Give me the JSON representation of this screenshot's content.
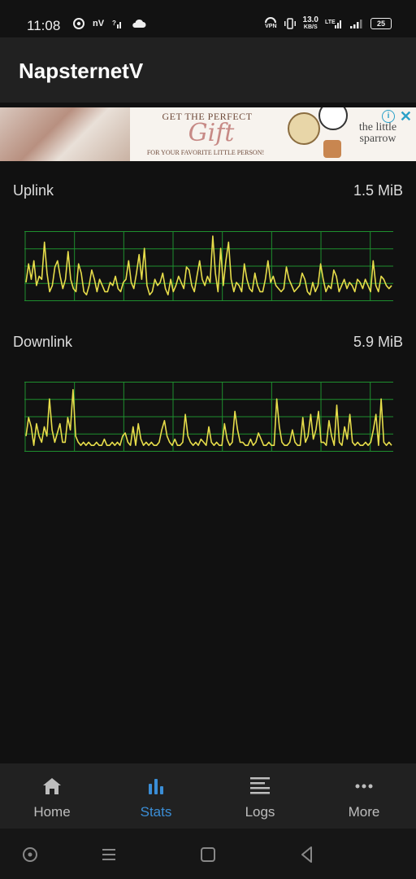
{
  "status_bar": {
    "time": "11:08",
    "carrier_badge": "nV",
    "network_speed": "13.0",
    "network_speed_unit": "KB/S",
    "vpn_label": "VPN",
    "battery": "25",
    "icons": [
      "chrome-icon",
      "signal-question-icon",
      "cloud-icon",
      "vpn-icon",
      "vibrate-icon",
      "lte-icon",
      "signal-icon",
      "battery-icon"
    ]
  },
  "app_bar": {
    "title": "NapsternetV"
  },
  "ad_banner": {
    "headline": "GET THE PERFECT",
    "gift_word": "Gift",
    "subline": "FOR YOUR FAVORITE LITTLE PERSON!",
    "brand": "the little sparrow",
    "info_glyph": "i",
    "close_glyph": "✕"
  },
  "uplink": {
    "label": "Uplink",
    "value": "1.5 MiB"
  },
  "downlink": {
    "label": "Downlink",
    "value": "5.9 MiB"
  },
  "chart_data": [
    {
      "type": "line",
      "series": [
        {
          "values": [
            0.25,
            0.55,
            0.3,
            0.6,
            0.2,
            0.35,
            0.3,
            0.9,
            0.4,
            0.1,
            0.2,
            0.5,
            0.6,
            0.35,
            0.15,
            0.3,
            0.75,
            0.3,
            0.15,
            0.1,
            0.55,
            0.4,
            0.1,
            0.05,
            0.2,
            0.45,
            0.3,
            0.1,
            0.3,
            0.2,
            0.1,
            0.1,
            0.25,
            0.2,
            0.35,
            0.15,
            0.1,
            0.25,
            0.3,
            0.6,
            0.25,
            0.15,
            0.4,
            0.7,
            0.3,
            0.8,
            0.2,
            0.05,
            0.1,
            0.3,
            0.2,
            0.25,
            0.4,
            0.15,
            0.05,
            0.3,
            0.1,
            0.2,
            0.35,
            0.25,
            0.15,
            0.5,
            0.45,
            0.2,
            0.1,
            0.35,
            0.6,
            0.3,
            0.2,
            0.35,
            0.25,
            1.0,
            0.4,
            0.1,
            0.8,
            0.2,
            0.6,
            0.9,
            0.3,
            0.1,
            0.25,
            0.2,
            0.1,
            0.55,
            0.3,
            0.15,
            0.1,
            0.4,
            0.2,
            0.1,
            0.1,
            0.3,
            0.6,
            0.25,
            0.35,
            0.2,
            0.15,
            0.1,
            0.15,
            0.5,
            0.3,
            0.2,
            0.1,
            0.15,
            0.2,
            0.4,
            0.3,
            0.1,
            0.05,
            0.25,
            0.1,
            0.2,
            0.55,
            0.3,
            0.1,
            0.2,
            0.15,
            0.45,
            0.35,
            0.1,
            0.2,
            0.3,
            0.15,
            0.25,
            0.2,
            0.1,
            0.3,
            0.25,
            0.15,
            0.3,
            0.2,
            0.1,
            0.6,
            0.2,
            0.1,
            0.35,
            0.3,
            0.2,
            0.15,
            0.2
          ]
        }
      ]
    },
    {
      "type": "line",
      "series": [
        {
          "values": [
            0.2,
            0.5,
            0.35,
            0.05,
            0.4,
            0.2,
            0.1,
            0.35,
            0.2,
            0.8,
            0.3,
            0.1,
            0.25,
            0.4,
            0.1,
            0.1,
            0.5,
            0.3,
            0.95,
            0.2,
            0.1,
            0.05,
            0.1,
            0.05,
            0.1,
            0.05,
            0.05,
            0.1,
            0.05,
            0.05,
            0.15,
            0.05,
            0.05,
            0.1,
            0.05,
            0.1,
            0.05,
            0.2,
            0.25,
            0.1,
            0.05,
            0.35,
            0.05,
            0.4,
            0.15,
            0.05,
            0.1,
            0.05,
            0.1,
            0.05,
            0.05,
            0.1,
            0.3,
            0.45,
            0.2,
            0.1,
            0.05,
            0.15,
            0.05,
            0.05,
            0.1,
            0.55,
            0.2,
            0.1,
            0.05,
            0.1,
            0.05,
            0.15,
            0.1,
            0.05,
            0.35,
            0.1,
            0.05,
            0.1,
            0.05,
            0.05,
            0.4,
            0.15,
            0.05,
            0.1,
            0.6,
            0.3,
            0.1,
            0.1,
            0.05,
            0.05,
            0.15,
            0.05,
            0.1,
            0.25,
            0.15,
            0.05,
            0.05,
            0.1,
            0.05,
            0.05,
            0.8,
            0.35,
            0.1,
            0.05,
            0.05,
            0.1,
            0.3,
            0.1,
            0.05,
            0.05,
            0.5,
            0.1,
            0.2,
            0.55,
            0.15,
            0.3,
            0.6,
            0.1,
            0.1,
            0.05,
            0.45,
            0.2,
            0.05,
            0.7,
            0.1,
            0.05,
            0.35,
            0.15,
            0.55,
            0.1,
            0.05,
            0.1,
            0.05,
            0.05,
            0.1,
            0.05,
            0.1,
            0.3,
            0.55,
            0.05,
            0.8,
            0.1,
            0.05,
            0.1,
            0.05
          ]
        }
      ]
    }
  ],
  "bottom_nav": {
    "items": [
      {
        "label": "Home",
        "icon": "home-icon",
        "active": false
      },
      {
        "label": "Stats",
        "icon": "bar-chart-icon",
        "active": true
      },
      {
        "label": "Logs",
        "icon": "list-icon",
        "active": false
      },
      {
        "label": "More",
        "icon": "more-dots-icon",
        "active": false
      }
    ]
  },
  "colors": {
    "graph_line": "#e6dc4a",
    "graph_grid": "#1e8f2e",
    "active_tab": "#3b8ed6"
  }
}
